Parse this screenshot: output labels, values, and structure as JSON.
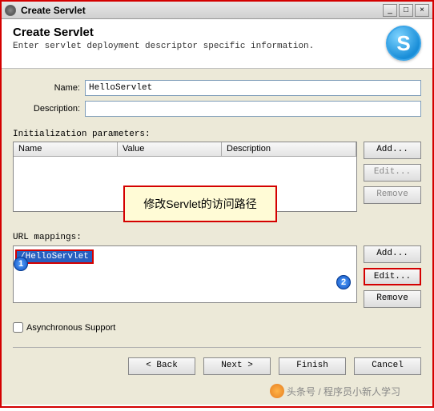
{
  "titlebar": {
    "title": "Create Servlet"
  },
  "header": {
    "title": "Create Servlet",
    "subtitle": "Enter servlet deployment descriptor specific information.",
    "icon_letter": "S"
  },
  "form": {
    "name_label": "Name:",
    "name_value": "HelloServlet",
    "desc_label": "Description:",
    "desc_value": ""
  },
  "init_params": {
    "label": "Initialization parameters:",
    "columns": {
      "name": "Name",
      "value": "Value",
      "desc": "Description"
    },
    "buttons": {
      "add": "Add...",
      "edit": "Edit...",
      "remove": "Remove"
    }
  },
  "callout": {
    "text": "修改Servlet的访问路径"
  },
  "url_mappings": {
    "label": "URL mappings:",
    "items": [
      "/HelloServlet"
    ],
    "buttons": {
      "add": "Add...",
      "edit": "Edit...",
      "remove": "Remove"
    }
  },
  "markers": {
    "m1": "1",
    "m2": "2"
  },
  "async": {
    "label": "Asynchronous Support",
    "checked": false
  },
  "footer": {
    "back": "< Back",
    "next": "Next >",
    "finish": "Finish",
    "cancel": "Cancel"
  },
  "watermark": "头条号 / 程序员小新人学习"
}
